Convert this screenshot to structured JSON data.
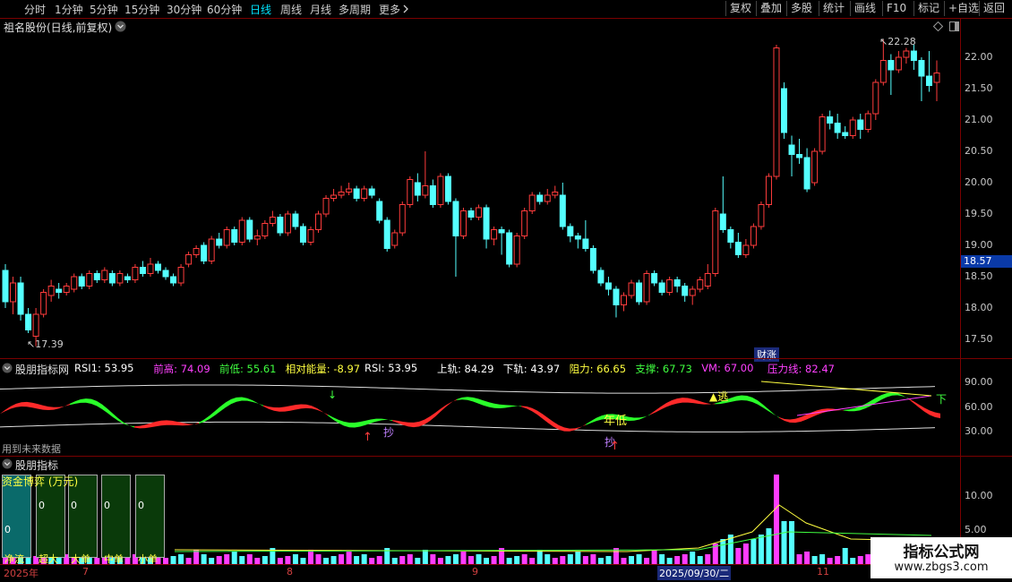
{
  "toolbar": {
    "periods": [
      "分时",
      "1分钟",
      "5分钟",
      "15分钟",
      "30分钟",
      "60分钟",
      "日线",
      "周线",
      "月线",
      "多周期",
      "更多"
    ],
    "active_index": 6,
    "more_icon": "chevron-right-icon",
    "right_buttons": [
      "复权",
      "叠加",
      "多股",
      "统计",
      "画线",
      "F10",
      "标记",
      "+自选",
      "返回"
    ]
  },
  "main_panel": {
    "title": "祖名股份(日线,前复权)",
    "dropdown_icon": "chevron-down-icon",
    "high_label": "22.28",
    "low_label": "17.39",
    "event_badge": "财涨",
    "cursor_price": "18.57",
    "price_ticks": [
      "22.00",
      "21.50",
      "21.00",
      "20.50",
      "20.00",
      "19.50",
      "19.00",
      "18.50",
      "18.00",
      "17.50"
    ]
  },
  "indicator1": {
    "name": "股朋指标网",
    "items": [
      {
        "label": "RSI1: 53.95",
        "color": "#ffffff"
      },
      {
        "label": "前高: 74.09",
        "color": "#ff40ff"
      },
      {
        "label": "前低: 55.61",
        "color": "#40ff40"
      },
      {
        "label": "相对能量: -8.97",
        "color": "#ffff40"
      },
      {
        "label": "RSI: 53.95",
        "color": "#ffffff"
      },
      {
        "label": "上轨: 84.29",
        "color": "#ffffff"
      },
      {
        "label": "下轨: 43.97",
        "color": "#ffffff"
      },
      {
        "label": "阻力: 66.65",
        "color": "#ffff40"
      },
      {
        "label": "支撑: 67.73",
        "color": "#40ff40"
      },
      {
        "label": "VM: 67.00",
        "color": "#ff40ff"
      },
      {
        "label": "压力线: 82.47",
        "color": "#ff40ff"
      }
    ],
    "ticks": [
      "90.00",
      "60.00",
      "30.00"
    ],
    "note": "用到未来数据",
    "marks": {
      "escape": "逃",
      "down": "下",
      "buy": "抄",
      "year_low": "年低"
    }
  },
  "indicator2": {
    "name": "股朋指标",
    "boxes_title": "资金博弈 (万元)",
    "box_values": [
      "0",
      "0",
      "0",
      "0",
      "0"
    ],
    "box_labels": [
      "净流",
      "超大",
      "大单",
      "中单",
      "小单"
    ],
    "ticks": [
      "10.00",
      "5.00"
    ]
  },
  "dates": [
    "2025年",
    "7",
    "8",
    "9",
    "2025/09/30/二",
    "11"
  ],
  "watermark": {
    "title": "指标公式网",
    "url": "www.zbgs3.com"
  },
  "colors": {
    "up": "#ff3c3c",
    "down": "#54ffff",
    "frame": "#7a0000",
    "accent": "#00e5ff"
  },
  "chart_data": {
    "type": "candlestick",
    "ylim": [
      17.2,
      22.4
    ],
    "candles": [
      [
        18.6,
        18.1,
        18.7,
        18.0
      ],
      [
        18.1,
        18.4,
        18.5,
        17.9
      ],
      [
        18.4,
        17.9,
        18.5,
        17.8
      ],
      [
        17.9,
        17.65,
        18.0,
        17.6
      ],
      [
        17.55,
        17.9,
        18.0,
        17.39
      ],
      [
        17.9,
        18.25,
        18.3,
        17.85
      ],
      [
        18.2,
        18.35,
        18.45,
        18.1
      ],
      [
        18.3,
        18.25,
        18.4,
        18.15
      ],
      [
        18.25,
        18.35,
        18.4,
        18.2
      ],
      [
        18.3,
        18.5,
        18.55,
        18.25
      ],
      [
        18.5,
        18.35,
        18.55,
        18.3
      ],
      [
        18.35,
        18.55,
        18.6,
        18.3
      ],
      [
        18.55,
        18.45,
        18.6,
        18.4
      ],
      [
        18.45,
        18.6,
        18.65,
        18.4
      ],
      [
        18.55,
        18.4,
        18.6,
        18.35
      ],
      [
        18.4,
        18.55,
        18.6,
        18.35
      ],
      [
        18.5,
        18.45,
        18.55,
        18.4
      ],
      [
        18.45,
        18.65,
        18.7,
        18.4
      ],
      [
        18.65,
        18.55,
        18.75,
        18.5
      ],
      [
        18.55,
        18.7,
        18.8,
        18.5
      ],
      [
        18.7,
        18.6,
        18.75,
        18.55
      ],
      [
        18.6,
        18.5,
        18.65,
        18.45
      ],
      [
        18.5,
        18.4,
        18.55,
        18.35
      ],
      [
        18.4,
        18.65,
        18.7,
        18.35
      ],
      [
        18.7,
        18.85,
        18.9,
        18.65
      ],
      [
        18.85,
        18.95,
        19.0,
        18.8
      ],
      [
        19.0,
        18.75,
        19.05,
        18.7
      ],
      [
        18.75,
        19.1,
        19.15,
        18.7
      ],
      [
        19.1,
        19.0,
        19.2,
        18.95
      ],
      [
        19.0,
        19.25,
        19.3,
        18.95
      ],
      [
        19.25,
        19.05,
        19.3,
        19.0
      ],
      [
        19.05,
        19.4,
        19.45,
        19.0
      ],
      [
        19.4,
        19.1,
        19.45,
        19.05
      ],
      [
        19.1,
        19.15,
        19.25,
        19.0
      ],
      [
        19.15,
        19.35,
        19.4,
        19.1
      ],
      [
        19.35,
        19.45,
        19.55,
        19.3
      ],
      [
        19.45,
        19.2,
        19.5,
        19.15
      ],
      [
        19.2,
        19.5,
        19.55,
        19.15
      ],
      [
        19.5,
        19.3,
        19.55,
        19.25
      ],
      [
        19.3,
        19.05,
        19.35,
        19.0
      ],
      [
        19.05,
        19.25,
        19.3,
        19.0
      ],
      [
        19.25,
        19.5,
        19.55,
        19.2
      ],
      [
        19.5,
        19.75,
        19.8,
        19.45
      ],
      [
        19.75,
        19.8,
        19.9,
        19.7
      ],
      [
        19.8,
        19.85,
        19.95,
        19.75
      ],
      [
        19.85,
        19.9,
        20.0,
        19.8
      ],
      [
        19.9,
        19.75,
        19.95,
        19.7
      ],
      [
        19.75,
        19.9,
        19.95,
        19.7
      ],
      [
        19.9,
        19.8,
        19.95,
        19.75
      ],
      [
        19.7,
        19.4,
        19.75,
        19.35
      ],
      [
        19.4,
        18.95,
        19.45,
        18.9
      ],
      [
        19.0,
        19.2,
        19.25,
        18.95
      ],
      [
        19.2,
        19.65,
        19.7,
        19.15
      ],
      [
        19.65,
        20.05,
        20.1,
        19.6
      ],
      [
        20.0,
        19.8,
        20.15,
        19.7
      ],
      [
        19.8,
        19.95,
        20.5,
        19.75
      ],
      [
        19.95,
        19.65,
        20.05,
        19.6
      ],
      [
        19.65,
        20.1,
        20.15,
        19.6
      ],
      [
        20.1,
        19.7,
        20.15,
        19.65
      ],
      [
        19.7,
        19.15,
        19.75,
        18.5
      ],
      [
        19.15,
        19.55,
        19.6,
        19.1
      ],
      [
        19.55,
        19.45,
        19.6,
        19.4
      ],
      [
        19.45,
        19.6,
        19.65,
        19.4
      ],
      [
        19.6,
        19.1,
        19.65,
        18.95
      ],
      [
        19.1,
        19.25,
        19.3,
        19.0
      ],
      [
        19.25,
        19.2,
        19.3,
        18.85
      ],
      [
        19.2,
        18.7,
        19.25,
        18.65
      ],
      [
        18.7,
        19.15,
        19.2,
        18.65
      ],
      [
        19.15,
        19.55,
        19.6,
        19.1
      ],
      [
        19.55,
        19.8,
        19.85,
        19.5
      ],
      [
        19.8,
        19.7,
        19.85,
        19.65
      ],
      [
        19.7,
        19.8,
        19.9,
        19.65
      ],
      [
        19.8,
        19.85,
        19.95,
        19.75
      ],
      [
        19.8,
        19.3,
        20.0,
        19.25
      ],
      [
        19.3,
        19.15,
        19.35,
        19.05
      ],
      [
        19.15,
        19.1,
        19.2,
        18.95
      ],
      [
        19.1,
        18.95,
        19.4,
        18.9
      ],
      [
        18.95,
        18.6,
        19.0,
        18.55
      ],
      [
        18.6,
        18.4,
        18.65,
        18.35
      ],
      [
        18.4,
        18.3,
        18.5,
        18.2
      ],
      [
        18.3,
        18.05,
        18.35,
        17.85
      ],
      [
        18.05,
        18.2,
        18.25,
        17.95
      ],
      [
        18.2,
        18.4,
        18.45,
        18.15
      ],
      [
        18.4,
        18.1,
        18.45,
        18.05
      ],
      [
        18.1,
        18.55,
        18.6,
        18.05
      ],
      [
        18.55,
        18.4,
        18.6,
        18.35
      ],
      [
        18.4,
        18.25,
        18.45,
        18.2
      ],
      [
        18.25,
        18.45,
        18.5,
        18.2
      ],
      [
        18.45,
        18.35,
        18.5,
        18.25
      ],
      [
        18.35,
        18.2,
        18.4,
        18.1
      ],
      [
        18.2,
        18.3,
        18.35,
        18.05
      ],
      [
        18.3,
        18.45,
        18.5,
        18.25
      ],
      [
        18.35,
        18.55,
        18.7,
        18.3
      ],
      [
        18.55,
        19.55,
        19.6,
        18.5
      ],
      [
        19.5,
        19.25,
        20.1,
        19.2
      ],
      [
        19.25,
        19.05,
        19.3,
        18.95
      ],
      [
        19.05,
        18.85,
        19.2,
        18.8
      ],
      [
        18.85,
        19.0,
        19.1,
        18.8
      ],
      [
        19.0,
        19.3,
        19.35,
        18.95
      ],
      [
        19.3,
        19.65,
        19.7,
        19.25
      ],
      [
        19.65,
        20.1,
        20.15,
        19.6
      ],
      [
        20.1,
        22.15,
        22.2,
        20.05
      ],
      [
        21.5,
        20.8,
        21.6,
        20.7
      ],
      [
        20.6,
        20.45,
        20.75,
        20.1
      ],
      [
        20.45,
        20.4,
        20.7,
        20.3
      ],
      [
        20.4,
        19.9,
        20.55,
        19.85
      ],
      [
        20.0,
        20.5,
        20.55,
        19.95
      ],
      [
        20.5,
        21.05,
        21.1,
        20.45
      ],
      [
        21.05,
        20.95,
        21.15,
        20.85
      ],
      [
        20.95,
        20.8,
        21.1,
        20.7
      ],
      [
        20.8,
        20.75,
        20.9,
        20.7
      ],
      [
        20.75,
        21.0,
        21.05,
        20.7
      ],
      [
        21.0,
        20.85,
        21.1,
        20.7
      ],
      [
        20.85,
        21.1,
        21.15,
        20.8
      ],
      [
        21.1,
        21.6,
        21.65,
        21.0
      ],
      [
        21.6,
        21.95,
        22.28,
        21.55
      ],
      [
        21.95,
        21.8,
        22.05,
        21.4
      ],
      [
        21.8,
        22.0,
        22.1,
        21.75
      ],
      [
        22.0,
        22.1,
        22.15,
        21.9
      ],
      [
        22.1,
        21.95,
        22.2,
        21.8
      ],
      [
        21.95,
        21.7,
        22.0,
        21.3
      ],
      [
        21.7,
        21.55,
        22.1,
        21.45
      ],
      [
        21.6,
        21.75,
        21.95,
        21.3
      ]
    ]
  }
}
